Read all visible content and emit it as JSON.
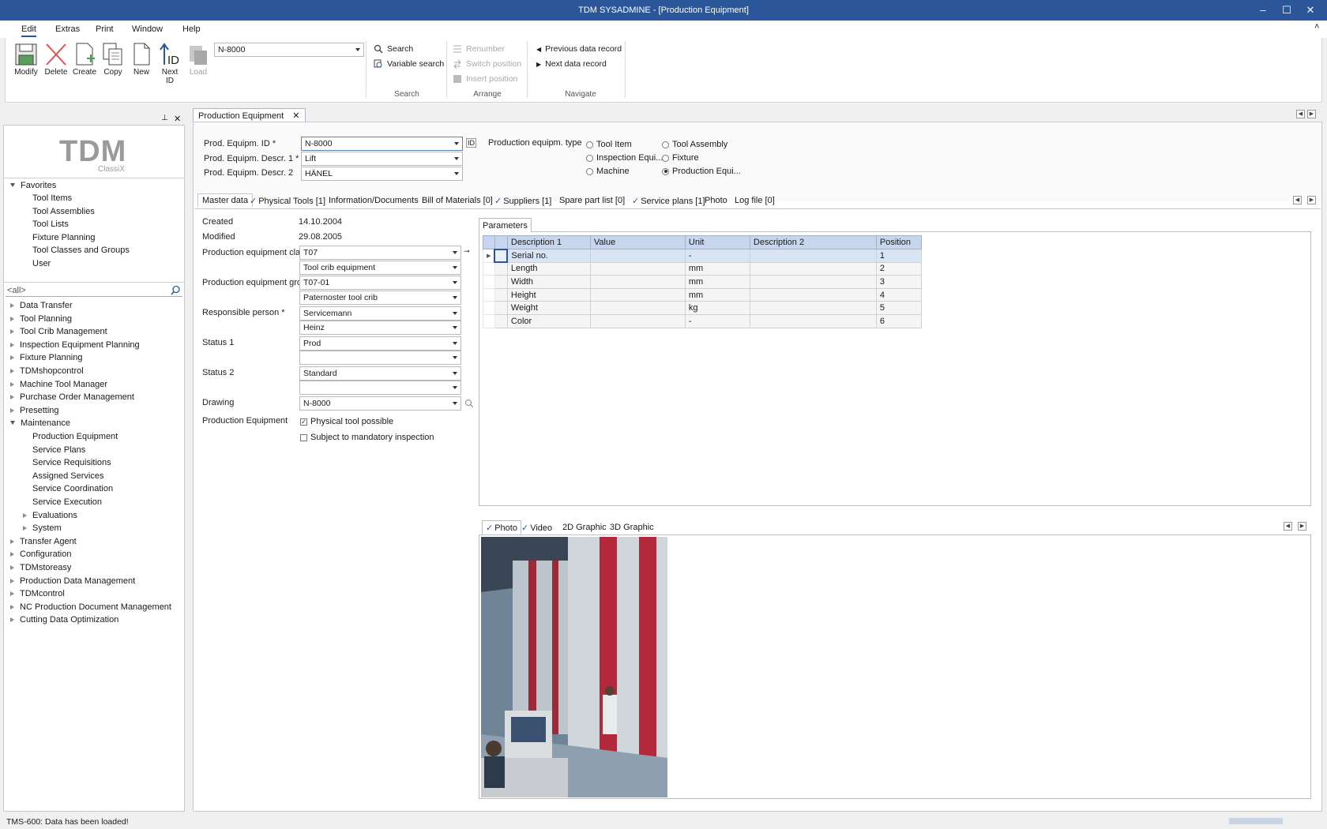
{
  "window": {
    "title": "TDM SYSADMINE - [Production Equipment]"
  },
  "menu": [
    "Edit",
    "Extras",
    "Print",
    "Window",
    "Help"
  ],
  "ribbon": {
    "buttons": [
      {
        "label": "Modify"
      },
      {
        "label": "Delete"
      },
      {
        "label": "Create"
      },
      {
        "label": "Copy"
      },
      {
        "label": "New"
      },
      {
        "label": "Next\nID"
      },
      {
        "label": "Load"
      }
    ],
    "id_combo": "N-8000",
    "search": {
      "search": "Search",
      "variable_search": "Variable search",
      "group": "Search"
    },
    "arrange": {
      "renumber": "Renumber",
      "switch": "Switch position",
      "insert": "Insert position",
      "group": "Arrange"
    },
    "navigate": {
      "prev": "Previous data record",
      "next": "Next data record",
      "group": "Navigate"
    }
  },
  "logo": {
    "big": "TDM",
    "small": "ClassiX"
  },
  "favorites": {
    "title": "Favorites",
    "items": [
      "Tool Items",
      "Tool Assemblies",
      "Tool Lists",
      "Fixture Planning",
      "Tool Classes and Groups",
      "User"
    ]
  },
  "filter": "<all>",
  "modules": {
    "top": [
      "Data Transfer",
      "Tool Planning",
      "Tool Crib Management",
      "Inspection Equipment Planning",
      "Fixture Planning",
      "TDMshopcontrol",
      "Machine Tool Manager",
      "Purchase Order Management",
      "Presetting"
    ],
    "maintenance": "Maintenance",
    "maintenance_items": [
      "Production Equipment",
      "Service Plans",
      "Service Requisitions",
      "Assigned Services",
      "Service Coordination",
      "Service Execution"
    ],
    "maintenance_sub": [
      "Evaluations",
      "System"
    ],
    "bottom": [
      "Transfer Agent",
      "Configuration",
      "TDMstoreasy",
      "Production Data Management",
      "TDMcontrol",
      "NC Production Document Management",
      "Cutting Data Optimization"
    ]
  },
  "doc_tab": "Production Equipment",
  "header": {
    "id_label": "Prod. Equipm. ID *",
    "id_value": "N-8000",
    "d1_label": "Prod. Equipm. Descr. 1 *",
    "d1_value": "Lift",
    "d2_label": "Prod. Equipm. Descr. 2",
    "d2_value": "HÄNEL",
    "type_label": "Production equipm. type",
    "types": [
      "Tool Item",
      "Tool Assembly",
      "Inspection Equi...",
      "Fixture",
      "Machine",
      "Production Equi..."
    ]
  },
  "tabs": [
    "Master data",
    "Physical Tools [1]",
    "Information/Documents",
    "Bill of Materials [0]",
    "Suppliers [1]",
    "Spare part list [0]",
    "Service plans [1]",
    "Photo",
    "Log file [0]"
  ],
  "master": {
    "created_label": "Created",
    "created": "14.10.2004",
    "modified_label": "Modified",
    "modified": "29.08.2005",
    "class_label": "Production equipment cla",
    "class": "T07",
    "class_desc": "Tool crib equipment",
    "group_label": "Production equipment gro",
    "group": "T07-01",
    "group_desc": "Paternoster tool crib",
    "resp_label": "Responsible person *",
    "resp": "Servicemann",
    "resp2": "Heinz",
    "status1_label": "Status 1",
    "status1": "Prod",
    "status2_label": "Status 2",
    "status2": "Standard",
    "drawing_label": "Drawing",
    "drawing": "N-8000",
    "pe_label": "Production Equipment",
    "chk1": "Physical tool possible",
    "chk2": "Subject to mandatory inspection"
  },
  "params": {
    "tab": "Parameters",
    "columns": [
      "Description 1",
      "Value",
      "Unit",
      "Description 2",
      "Position"
    ],
    "rows": [
      [
        "Serial no.",
        "",
        "-",
        "",
        "1"
      ],
      [
        "Length",
        "",
        "mm",
        "",
        "2"
      ],
      [
        "Width",
        "",
        "mm",
        "",
        "3"
      ],
      [
        "Height",
        "",
        "mm",
        "",
        "4"
      ],
      [
        "Weight",
        "",
        "kg",
        "",
        "5"
      ],
      [
        "Color",
        "",
        "-",
        "",
        "6"
      ]
    ]
  },
  "media_tabs": [
    "Photo",
    "Video",
    "2D Graphic",
    "3D Graphic"
  ],
  "status": "TMS-600: Data has been loaded!"
}
